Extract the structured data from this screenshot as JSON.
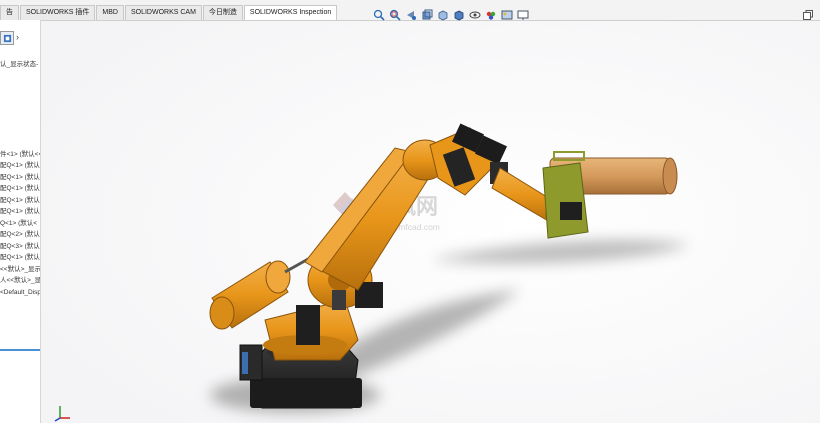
{
  "tabs": [
    {
      "label": "告",
      "active": false
    },
    {
      "label": "SOLIDWORKS 插件",
      "active": false
    },
    {
      "label": "MBD",
      "active": false
    },
    {
      "label": "SOLIDWORKS CAM",
      "active": false
    },
    {
      "label": "今日制造",
      "active": false
    },
    {
      "label": "SOLIDWORKS Inspection",
      "active": true
    }
  ],
  "hud_icons": [
    "zoom-to-fit-icon",
    "zoom-area-icon",
    "previous-view-icon",
    "section-view-icon",
    "view-orientation-icon",
    "display-style-icon",
    "hide-show-icon",
    "edit-appearance-icon",
    "scene-icon",
    "view-settings-icon"
  ],
  "panel": {
    "config_text": "认_显示状态-",
    "tree": [
      "件<1> (默认<<",
      "配Q<1> (默认",
      "配Q<1> (默认",
      "配Q<1> (默认",
      "配Q<1> (默认",
      "配Q<1> (默认",
      "Q<1> (默认<",
      "配Q<2> (默认",
      "配Q<3> (默认",
      "配Q<1> (默认",
      "<<默认>_显示",
      "人<<默认>_显",
      "<Default_Disp"
    ]
  },
  "watermark": {
    "cn": "沐风网",
    "url": "www.mfcad.com"
  },
  "colors": {
    "robot_orange": "#e8961a",
    "base_black": "#202020",
    "pipe_tan": "#d59a5c",
    "fixture_green": "#8f9a2c",
    "accent_blue": "#4a90d9"
  }
}
